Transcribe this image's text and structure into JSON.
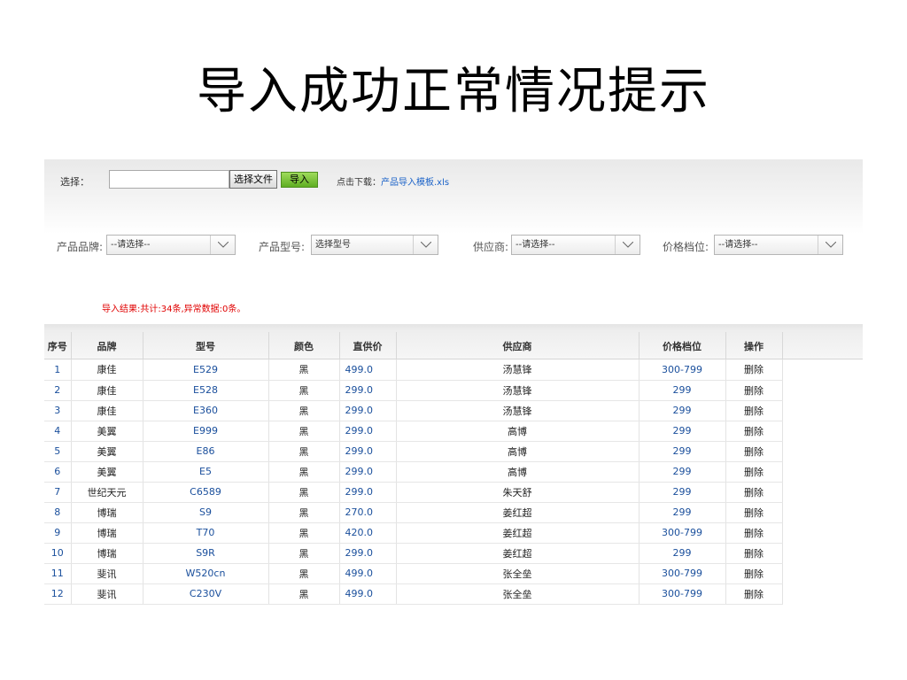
{
  "title": "导入成功正常情况提示",
  "toolbar": {
    "select_label": "选择：",
    "file_value": "",
    "file_button": "选择文件",
    "import_button": "导入",
    "download_label": "点击下载：",
    "download_link": "产品导入模板.xls"
  },
  "filters": {
    "brand": {
      "label": "产品品牌:",
      "value": "--请选择--"
    },
    "model": {
      "label": "产品型号:",
      "value": "选择型号"
    },
    "supplier": {
      "label": "供应商:",
      "value": "--请选择--"
    },
    "price": {
      "label": "价格档位:",
      "value": "--请选择--"
    }
  },
  "result_message": "导入结果:共计:34条,异常数据:0条。",
  "table": {
    "headers": [
      "序号",
      "品牌",
      "型号",
      "颜色",
      "直供价",
      "供应商",
      "价格档位",
      "操作"
    ],
    "rows": [
      {
        "idx": "1",
        "brand": "康佳",
        "model": "E529",
        "color": "黑",
        "price": "499.0",
        "supplier": "汤慧锋",
        "tier": "300-799",
        "action": "删除"
      },
      {
        "idx": "2",
        "brand": "康佳",
        "model": "E528",
        "color": "黑",
        "price": "299.0",
        "supplier": "汤慧锋",
        "tier": "299",
        "action": "删除"
      },
      {
        "idx": "3",
        "brand": "康佳",
        "model": "E360",
        "color": "黑",
        "price": "299.0",
        "supplier": "汤慧锋",
        "tier": "299",
        "action": "删除"
      },
      {
        "idx": "4",
        "brand": "美翼",
        "model": "E999",
        "color": "黑",
        "price": "299.0",
        "supplier": "高博",
        "tier": "299",
        "action": "删除"
      },
      {
        "idx": "5",
        "brand": "美翼",
        "model": "E86",
        "color": "黑",
        "price": "299.0",
        "supplier": "高博",
        "tier": "299",
        "action": "删除"
      },
      {
        "idx": "6",
        "brand": "美翼",
        "model": "E5",
        "color": "黑",
        "price": "299.0",
        "supplier": "高博",
        "tier": "299",
        "action": "删除"
      },
      {
        "idx": "7",
        "brand": "世纪天元",
        "model": "C6589",
        "color": "黑",
        "price": "299.0",
        "supplier": "朱天舒",
        "tier": "299",
        "action": "删除"
      },
      {
        "idx": "8",
        "brand": "博瑞",
        "model": "S9",
        "color": "黑",
        "price": "270.0",
        "supplier": "姜红超",
        "tier": "299",
        "action": "删除"
      },
      {
        "idx": "9",
        "brand": "博瑞",
        "model": "T70",
        "color": "黑",
        "price": "420.0",
        "supplier": "姜红超",
        "tier": "300-799",
        "action": "删除"
      },
      {
        "idx": "10",
        "brand": "博瑞",
        "model": "S9R",
        "color": "黑",
        "price": "299.0",
        "supplier": "姜红超",
        "tier": "299",
        "action": "删除"
      },
      {
        "idx": "11",
        "brand": "斐讯",
        "model": "W520cn",
        "color": "黑",
        "price": "499.0",
        "supplier": "张全垒",
        "tier": "300-799",
        "action": "删除"
      },
      {
        "idx": "12",
        "brand": "斐讯",
        "model": "C230V",
        "color": "黑",
        "price": "499.0",
        "supplier": "张全垒",
        "tier": "300-799",
        "action": "删除"
      }
    ]
  }
}
